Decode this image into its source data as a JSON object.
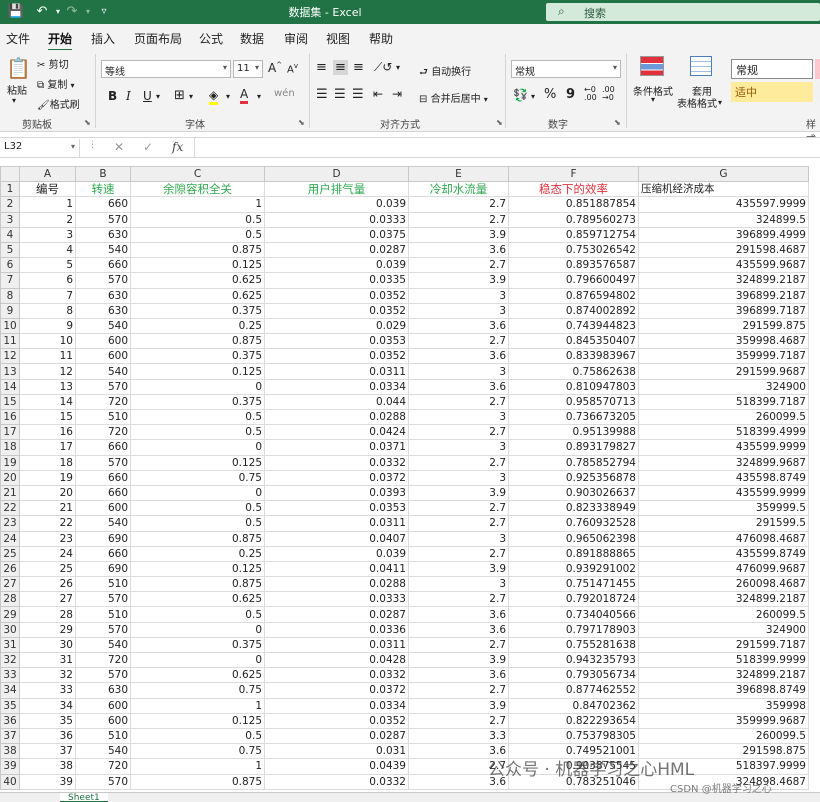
{
  "titlebar": {
    "title": "数据集 - Excel",
    "save_icon": "save-icon",
    "undo_icon": "undo-icon",
    "redo_icon": "redo-icon",
    "search_placeholder": "搜索"
  },
  "tabs": [
    "文件",
    "开始",
    "插入",
    "页面布局",
    "公式",
    "数据",
    "审阅",
    "视图",
    "帮助"
  ],
  "active_tab": "开始",
  "ribbon": {
    "clipboard": {
      "paste": "粘贴",
      "cut": "剪切",
      "copy": "复制",
      "format_painter": "格式刷",
      "label": "剪贴板"
    },
    "font": {
      "name": "等线",
      "size": "11",
      "bold": "B",
      "italic": "I",
      "underline": "U",
      "label": "字体",
      "grow": "A",
      "shrink": "A",
      "font_color_letter": "A"
    },
    "alignment": {
      "wrap_text": "自动换行",
      "merge_center": "合并后居中",
      "label": "对齐方式"
    },
    "number": {
      "format": "常规",
      "percent": "%",
      "comma": "9",
      "label": "数字"
    },
    "styles": {
      "conditional": "条件格式",
      "table_line1": "套用",
      "table_line2": "表格格式",
      "normal": "常规",
      "neutral": "适中",
      "label_partial": "样式"
    }
  },
  "formula_bar": {
    "name_box": "L32",
    "cancel": "✕",
    "enter": "✓",
    "fx": "fx",
    "value": ""
  },
  "grid": {
    "columns": [
      "A",
      "B",
      "C",
      "D",
      "E",
      "F",
      "G"
    ],
    "headers": [
      "编号",
      "转速",
      "余隙容积全关",
      "用户排气量",
      "冷却水流量",
      "稳态下的效率",
      "压缩机经济成本"
    ],
    "rows": [
      [
        "1",
        "660",
        "1",
        "0.039",
        "2.7",
        "0.851887854",
        "435597.9999"
      ],
      [
        "2",
        "570",
        "0.5",
        "0.0333",
        "2.7",
        "0.789560273",
        "324899.5"
      ],
      [
        "3",
        "630",
        "0.5",
        "0.0375",
        "3.9",
        "0.859712754",
        "396899.4999"
      ],
      [
        "4",
        "540",
        "0.875",
        "0.0287",
        "3.6",
        "0.753026542",
        "291598.4687"
      ],
      [
        "5",
        "660",
        "0.125",
        "0.039",
        "2.7",
        "0.893576587",
        "435599.9687"
      ],
      [
        "6",
        "570",
        "0.625",
        "0.0335",
        "3.9",
        "0.796600497",
        "324899.2187"
      ],
      [
        "7",
        "630",
        "0.625",
        "0.0352",
        "3",
        "0.876594802",
        "396899.2187"
      ],
      [
        "8",
        "630",
        "0.375",
        "0.0352",
        "3",
        "0.874002892",
        "396899.7187"
      ],
      [
        "9",
        "540",
        "0.25",
        "0.029",
        "3.6",
        "0.743944823",
        "291599.875"
      ],
      [
        "10",
        "600",
        "0.875",
        "0.0353",
        "2.7",
        "0.845350407",
        "359998.4687"
      ],
      [
        "11",
        "600",
        "0.375",
        "0.0352",
        "3.6",
        "0.833983967",
        "359999.7187"
      ],
      [
        "12",
        "540",
        "0.125",
        "0.0311",
        "3",
        "0.75862638",
        "291599.9687"
      ],
      [
        "13",
        "570",
        "0",
        "0.0334",
        "3.6",
        "0.810947803",
        "324900"
      ],
      [
        "14",
        "720",
        "0.375",
        "0.044",
        "2.7",
        "0.958570713",
        "518399.7187"
      ],
      [
        "15",
        "510",
        "0.5",
        "0.0288",
        "3",
        "0.736673205",
        "260099.5"
      ],
      [
        "16",
        "720",
        "0.5",
        "0.0424",
        "2.7",
        "0.95139988",
        "518399.4999"
      ],
      [
        "17",
        "660",
        "0",
        "0.0371",
        "3",
        "0.893179827",
        "435599.9999"
      ],
      [
        "18",
        "570",
        "0.125",
        "0.0332",
        "2.7",
        "0.785852794",
        "324899.9687"
      ],
      [
        "19",
        "660",
        "0.75",
        "0.0372",
        "3",
        "0.925356878",
        "435598.8749"
      ],
      [
        "20",
        "660",
        "0",
        "0.0393",
        "3.9",
        "0.903026637",
        "435599.9999"
      ],
      [
        "21",
        "600",
        "0.5",
        "0.0353",
        "2.7",
        "0.823338949",
        "359999.5"
      ],
      [
        "22",
        "540",
        "0.5",
        "0.0311",
        "2.7",
        "0.760932528",
        "291599.5"
      ],
      [
        "23",
        "690",
        "0.875",
        "0.0407",
        "3",
        "0.965062398",
        "476098.4687"
      ],
      [
        "24",
        "660",
        "0.25",
        "0.039",
        "2.7",
        "0.891888865",
        "435599.8749"
      ],
      [
        "25",
        "690",
        "0.125",
        "0.0411",
        "3.9",
        "0.939291002",
        "476099.9687"
      ],
      [
        "26",
        "510",
        "0.875",
        "0.0288",
        "3",
        "0.751471455",
        "260098.4687"
      ],
      [
        "27",
        "570",
        "0.625",
        "0.0333",
        "2.7",
        "0.792018724",
        "324899.2187"
      ],
      [
        "28",
        "510",
        "0.5",
        "0.0287",
        "3.6",
        "0.734040566",
        "260099.5"
      ],
      [
        "29",
        "570",
        "0",
        "0.0336",
        "3.6",
        "0.797178903",
        "324900"
      ],
      [
        "30",
        "540",
        "0.375",
        "0.0311",
        "2.7",
        "0.755281638",
        "291599.7187"
      ],
      [
        "31",
        "720",
        "0",
        "0.0428",
        "3.9",
        "0.943235793",
        "518399.9999"
      ],
      [
        "32",
        "570",
        "0.625",
        "0.0332",
        "3.6",
        "0.793056734",
        "324899.2187"
      ],
      [
        "33",
        "630",
        "0.75",
        "0.0372",
        "2.7",
        "0.877462552",
        "396898.8749"
      ],
      [
        "34",
        "600",
        "1",
        "0.0334",
        "3.9",
        "0.84702362",
        "359998"
      ],
      [
        "35",
        "600",
        "0.125",
        "0.0352",
        "2.7",
        "0.822293654",
        "359999.9687"
      ],
      [
        "36",
        "510",
        "0.5",
        "0.0287",
        "3.3",
        "0.753798305",
        "260099.5"
      ],
      [
        "37",
        "540",
        "0.75",
        "0.031",
        "3.6",
        "0.749521001",
        "291598.875"
      ],
      [
        "38",
        "720",
        "1",
        "0.0439",
        "2.7",
        "0.903875545",
        "518397.9999"
      ],
      [
        "39",
        "570",
        "0.875",
        "0.0332",
        "3.6",
        "0.783251046",
        "324898.4687"
      ]
    ]
  },
  "sheet_tab": "Sheet1",
  "watermark": "公众号 · 机器学习之心HML",
  "watermark_small": "CSDN @机器学习之心",
  "colors": {
    "excel_green": "#217346",
    "header_green": "#2eaa4f",
    "header_red": "#e0313c",
    "neutral_yellow": "#ffeb9c"
  }
}
